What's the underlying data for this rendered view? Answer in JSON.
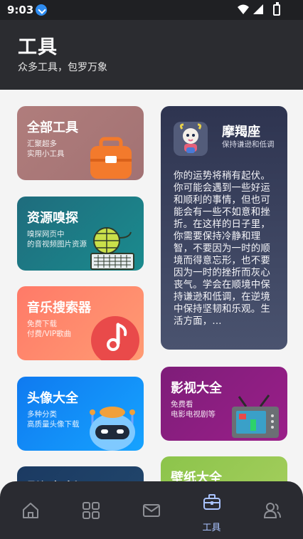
{
  "statusbar": {
    "time": "9:03"
  },
  "header": {
    "title": "工具",
    "subtitle": "众多工具，包罗万象"
  },
  "cards": {
    "all_tools": {
      "title": "全部工具",
      "desc1": "汇聚超多",
      "desc2": "实用小工具"
    },
    "resource": {
      "title": "资源嗅探",
      "desc1": "嗅探网页中",
      "desc2": "的音视频图片资源"
    },
    "music": {
      "title": "音乐搜索器",
      "desc1": "免费下载",
      "desc2": "付费/VIP歌曲"
    },
    "avatar": {
      "title": "头像大全",
      "desc1": "多种分类",
      "desc2": "高质量头像下载"
    },
    "partial_left": {
      "title": "影视解析"
    },
    "video": {
      "title": "影视大全",
      "desc1": "免费看",
      "desc2": "电影电视剧等"
    },
    "wallpaper": {
      "title": "壁纸大全"
    }
  },
  "horoscope": {
    "name": "摩羯座",
    "subtitle": "保持谦逊和低调",
    "text": "你的运势将稍有起伏。你可能会遇到一些好运和顺利的事情，但也可能会有一些不如意和挫折。在这样的日子里，你需要保持冷静和理智，不要因为一时的顺境而得意忘形，也不要因为一时的挫折而灰心丧气。学会在顺境中保持谦逊和低调，在逆境中保持坚韧和乐观。生活方面，..."
  },
  "tabbar": {
    "items": [
      {
        "icon": "home-icon"
      },
      {
        "icon": "grid-icon"
      },
      {
        "icon": "mail-icon"
      },
      {
        "icon": "toolbox-icon",
        "label": "工具",
        "active": true
      },
      {
        "icon": "users-icon"
      }
    ]
  },
  "colors": {
    "header_bg": "#2b2c30",
    "tab_active": "#a9c3ff",
    "tab_inactive": "#8e9096"
  }
}
